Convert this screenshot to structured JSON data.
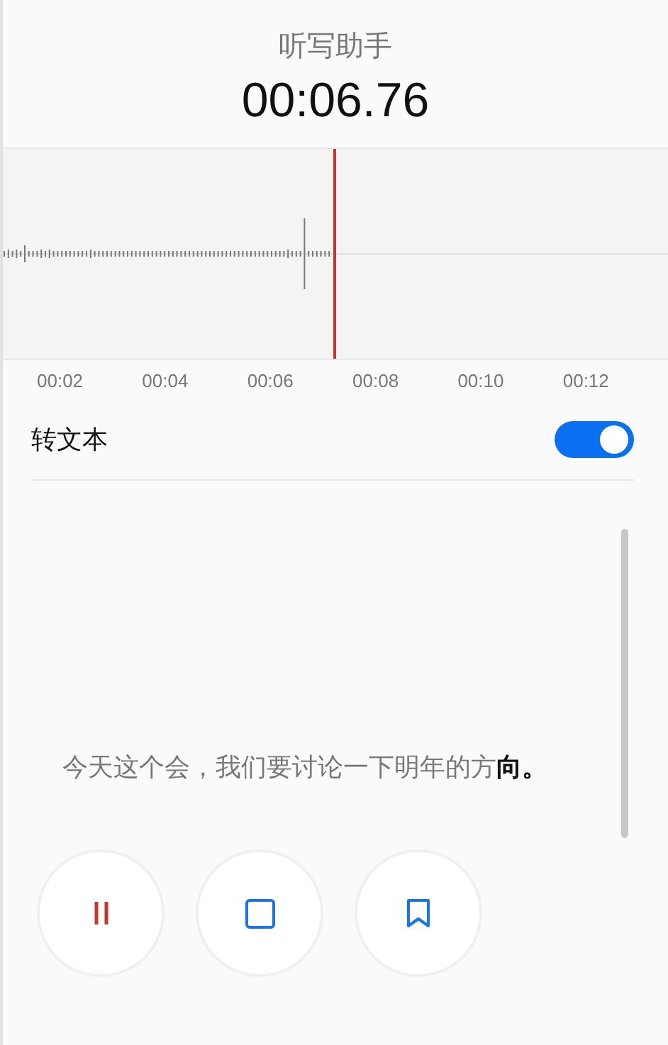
{
  "header": {
    "title": "听写助手",
    "elapsed": "00:06.76"
  },
  "timeline": {
    "ticks": [
      "00:02",
      "00:04",
      "00:06",
      "00:08",
      "00:10",
      "00:12"
    ]
  },
  "transcribe": {
    "label": "转文本",
    "on": true
  },
  "transcript": [
    {
      "text": "今天这个会，我们要讨论一下明年的方",
      "kind": "settled"
    },
    {
      "text": "向。",
      "kind": "live"
    }
  ],
  "controls": [
    {
      "kind": "pause"
    },
    {
      "kind": "stop"
    },
    {
      "kind": "bookmark"
    }
  ]
}
